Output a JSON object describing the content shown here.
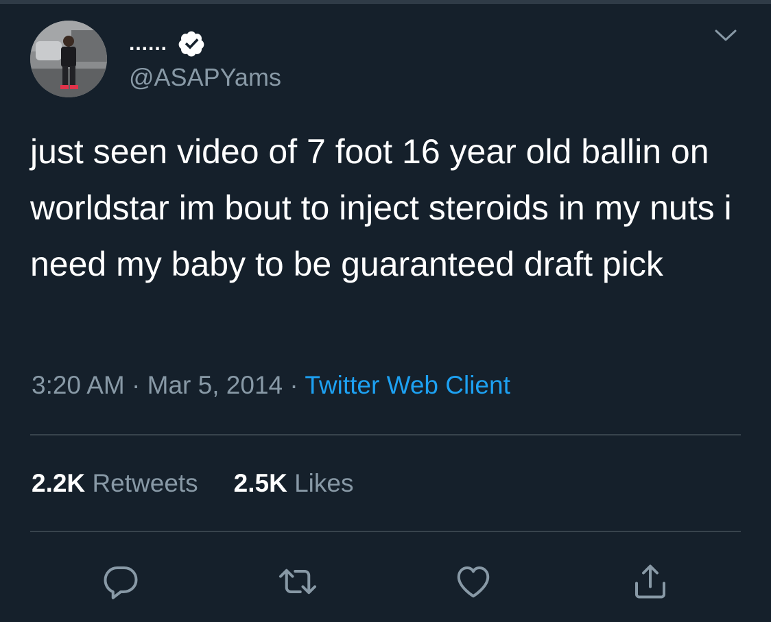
{
  "user": {
    "display_name": "......",
    "handle": "@ASAPYams",
    "verified": true
  },
  "tweet": {
    "text": "just seen video of 7 foot 16 year old ballin on worldstar im bout to inject steroids in my nuts i need my baby to be guaranteed draft pick",
    "time": "3:20 AM",
    "date": "Mar 5, 2014",
    "separator": "·",
    "source": "Twitter Web Client"
  },
  "stats": {
    "retweets_count": "2.2K",
    "retweets_label": "Retweets",
    "likes_count": "2.5K",
    "likes_label": "Likes"
  },
  "actions": {
    "reply_icon": "reply-icon",
    "retweet_icon": "retweet-icon",
    "like_icon": "heart-icon",
    "share_icon": "share-icon"
  },
  "colors": {
    "background": "#15202b",
    "text": "#ffffff",
    "secondary_text": "#8899a6",
    "link": "#1da1f2",
    "verified_badge": "#ffffff",
    "divider": "#38444d"
  }
}
